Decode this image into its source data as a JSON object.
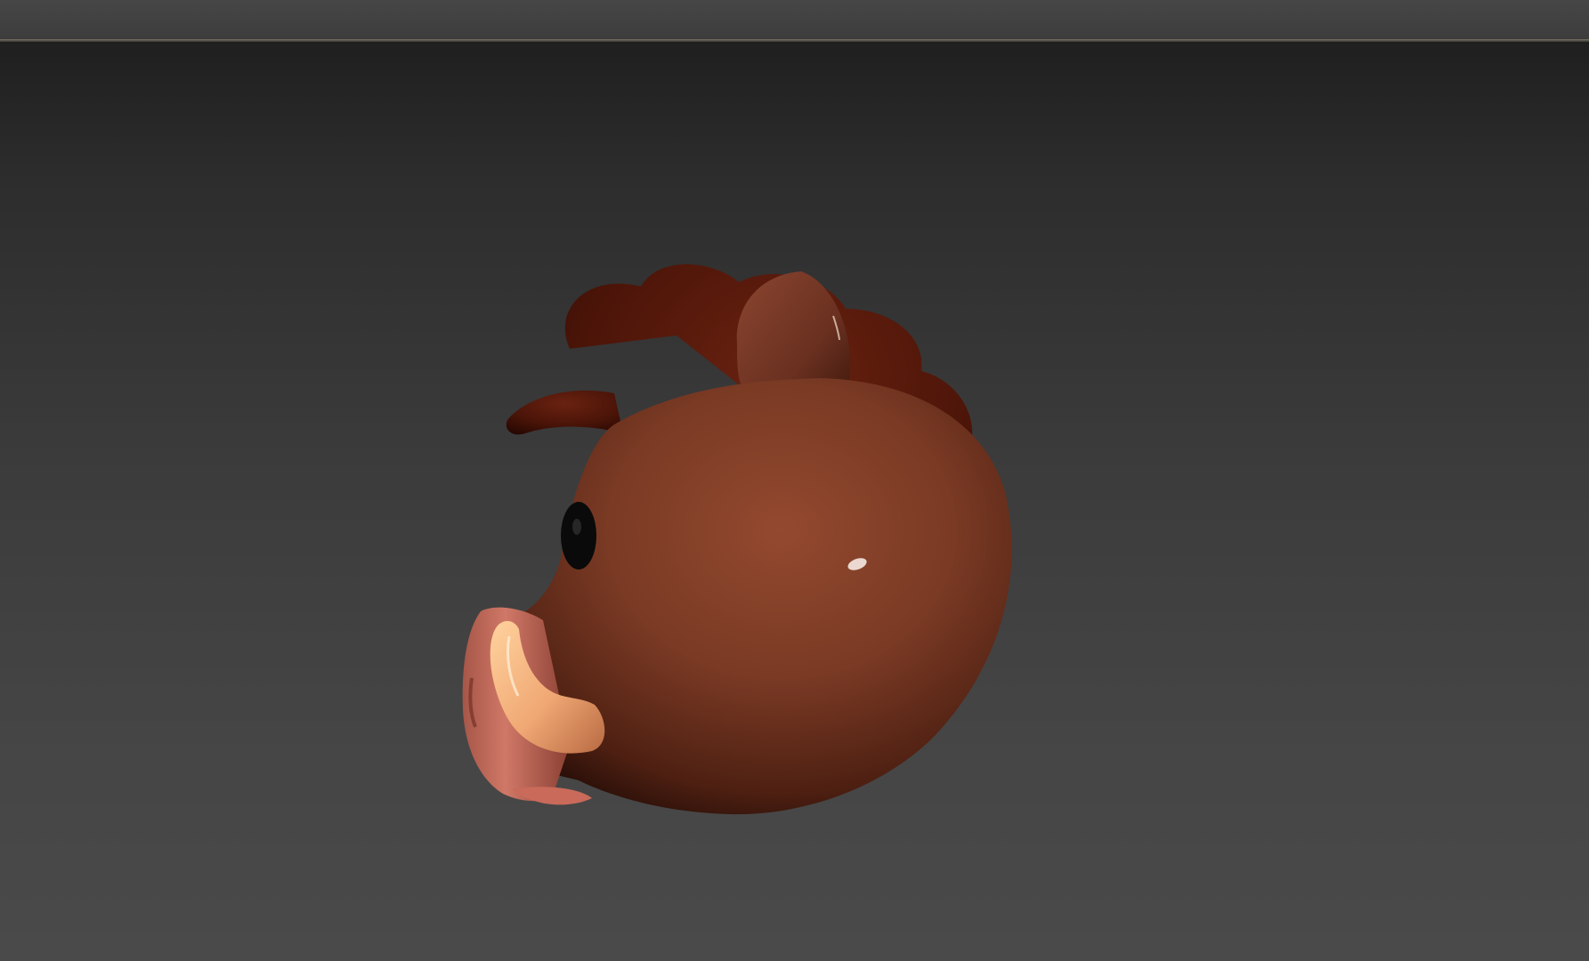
{
  "viewport": {
    "background_top": "#1f1f1f",
    "background_bottom": "#4a4a4a",
    "model": {
      "subject": "boar-head",
      "skin_color": "#7a3a24",
      "mane_color": "#4a1408",
      "tusk_color": "#f0b07a",
      "snout_color": "#c96a5a"
    }
  }
}
